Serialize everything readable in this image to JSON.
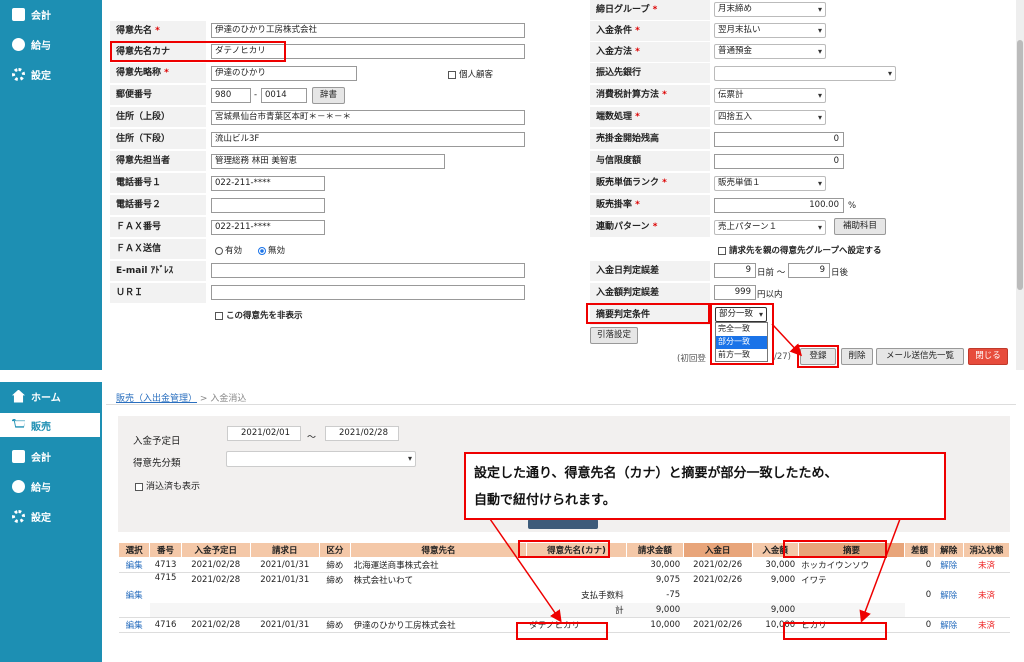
{
  "top_sidebar": {
    "items": [
      {
        "label": "会計",
        "icon": "calculator-icon"
      },
      {
        "label": "給与",
        "icon": "money-bag-icon"
      },
      {
        "label": "設定",
        "icon": "gear-icon"
      }
    ]
  },
  "bottom_sidebar": {
    "items": [
      {
        "label": "ホーム",
        "icon": "home-icon"
      },
      {
        "label": "販売",
        "icon": "cart-icon"
      },
      {
        "label": "会計",
        "icon": "calculator-icon"
      },
      {
        "label": "給与",
        "icon": "money-bag-icon"
      },
      {
        "label": "設定",
        "icon": "gear-icon"
      }
    ]
  },
  "form": {
    "customer_name_label": "得意先名",
    "customer_name": "伊達のひかり工房株式会社",
    "kana_label": "得意先名カナ",
    "kana": "ダテノヒカリ",
    "short_label": "得意先略称",
    "short": "伊達のひかり",
    "individual_label": "個人顧客",
    "postal_label": "郵便番号",
    "postal1": "980",
    "postal_dash": "-",
    "postal2": "0014",
    "dict_button": "辞書",
    "addr1_label": "住所（上段）",
    "addr1": "宮城県仙台市青葉区本町＊－＊－＊",
    "addr2_label": "住所（下段）",
    "addr2": "流山ビル3F",
    "contact_label": "得意先担当者",
    "contact": "管理総務 林田 美智恵",
    "tel1_label": "電話番号１",
    "tel1": "022-211-****",
    "tel2_label": "電話番号２",
    "tel2": "",
    "fax_label": "ＦＡＸ番号",
    "fax": "022-211-****",
    "faxsend_label": "ＦＡＸ送信",
    "faxsend_opt1": "有効",
    "faxsend_opt2": "無効",
    "email_label": "E-mail ｱﾄﾞﾚｽ",
    "email": "",
    "url_label": "ＵＲＩ",
    "url": "",
    "hide_label": "この得意先を非表示"
  },
  "right_form": {
    "closing_label": "締日グループ",
    "closing": "月末締め",
    "terms_label": "入金条件",
    "terms": "翌月末払い",
    "method_label": "入金方法",
    "method": "普通預金",
    "bank_label": "振込先銀行",
    "bank": "",
    "tax_calc_label": "消費税計算方法",
    "tax_calc": "伝票計",
    "rounding_label": "端数処理",
    "rounding": "四捨五入",
    "ar_start_label": "売掛金開始残高",
    "ar_start": "0",
    "credit_label": "与信限度額",
    "credit": "0",
    "price_rank_label": "販売単価ランク",
    "price_rank": "販売単価１",
    "rate_label": "販売掛率",
    "rate": "100.00",
    "rate_unit": "%",
    "pattern_label": "連動パターン",
    "pattern": "売上パターン１",
    "sub_button": "補助科目",
    "billing_check": "請求先を親の得意先グループへ設定する",
    "date_diff_label": "入金日判定誤差",
    "date_before": "9",
    "date_before_unit": "日前 ～",
    "date_after": "9",
    "date_after_unit": "日後",
    "amt_diff_label": "入金額判定誤差",
    "amt_diff": "999",
    "amt_unit": "円以内",
    "summary_label": "摘要判定条件",
    "summary_value": "部分一致",
    "summary_options": [
      "完全一致",
      "部分一致",
      "前方一致"
    ],
    "deduct_button": "引落設定",
    "footer_note_a": "(初回登",
    "footer_note_b": "/27)",
    "register_button": "登録",
    "delete_button": "削除",
    "mail_button": "メール送信先一覧",
    "close_button": "閉じる"
  },
  "breadcrumb": {
    "link": "販売（入出金管理）",
    "sep": ">",
    "current": "入金消込"
  },
  "filter": {
    "date_label": "入金予定日",
    "date_from": "2021/02/01",
    "tilde": "～",
    "date_to": "2021/02/28",
    "category_label": "得意先分類",
    "category": "",
    "show_cleared": "消込済も表示"
  },
  "callout": {
    "line1": "設定した通り、得意先名（カナ）と摘要が部分一致したため、",
    "line2": "自動で紐付けられます。"
  },
  "table": {
    "headers": [
      "選択",
      "番号",
      "入金予定日",
      "請求日",
      "区分",
      "得意先名",
      "得意先名(カナ)",
      "請求金額",
      "入金日",
      "入金額",
      "摘要",
      "差額",
      "解除",
      "消込状態"
    ],
    "rows": [
      {
        "sel": "編集",
        "no": "4713",
        "due": "2021/02/28",
        "bill": "2021/01/31",
        "kubun": "締め",
        "name": "北海運送商事株式会社",
        "kana": "",
        "billamt": "30,000",
        "paydate": "2021/02/26",
        "payamt": "30,000",
        "memo": "ホッカイウンソウ",
        "diff": "0",
        "cancel": "解除",
        "status": "未済"
      },
      {
        "sel": "編集",
        "no": "4715",
        "due": "2021/02/28",
        "bill": "2021/01/31",
        "kubun": "締め",
        "name": "株式会社いわて",
        "kana": "",
        "billamt": "9,075",
        "paydate": "2021/02/26",
        "payamt": "9,000",
        "memo": "イワテ",
        "diff": "0",
        "cancel": "解除",
        "status": "未済",
        "sub1_label": "支払手数料",
        "sub1_amt": "-75",
        "sub2_label": "計",
        "sub2_amt": "9,000",
        "sub2_pay": "9,000"
      },
      {
        "sel": "編集",
        "no": "4716",
        "due": "2021/02/28",
        "bill": "2021/01/31",
        "kubun": "締め",
        "name": "伊達のひかり工房株式会社",
        "kana": "ダテノヒカリ",
        "billamt": "10,000",
        "paydate": "2021/02/26",
        "payamt": "10,000",
        "memo": "ヒカリ",
        "diff": "0",
        "cancel": "解除",
        "status": "未済"
      }
    ]
  }
}
